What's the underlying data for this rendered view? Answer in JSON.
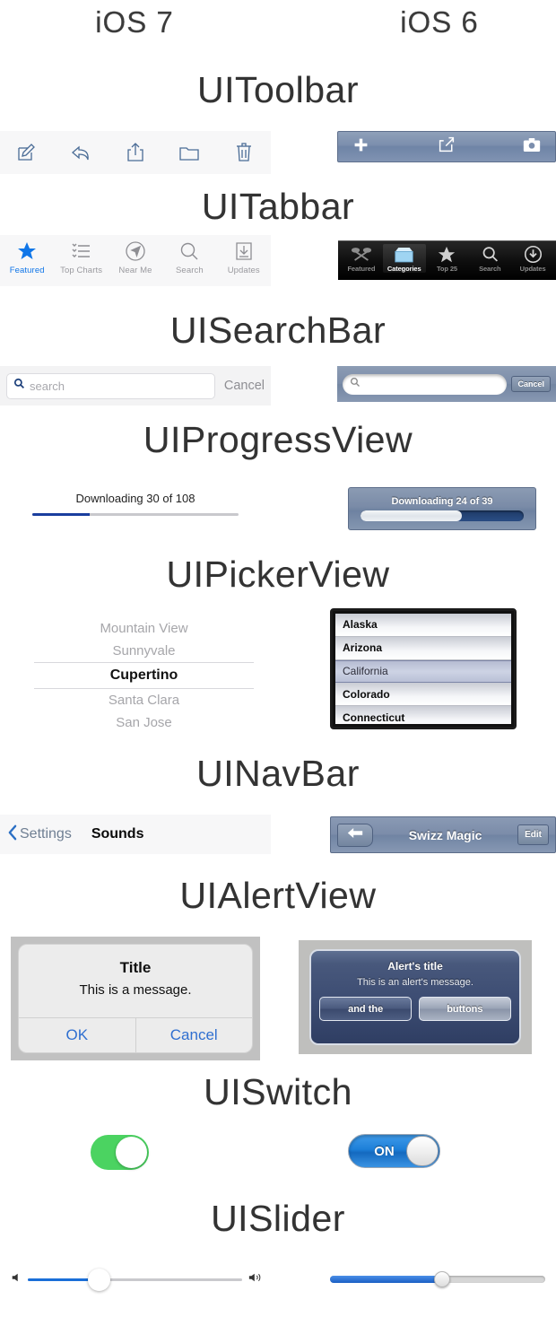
{
  "columns": {
    "left": "iOS 7",
    "right": "iOS 6"
  },
  "sections": {
    "toolbar": {
      "title": "UIToolbar"
    },
    "tabbar": {
      "title": "UITabbar"
    },
    "searchbar": {
      "title": "UISearchBar"
    },
    "progressview": {
      "title": "UIProgressView"
    },
    "pickerview": {
      "title": "UIPickerView"
    },
    "navbar": {
      "title": "UINavBar"
    },
    "alertview": {
      "title": "UIAlertView"
    },
    "uiswitch": {
      "title": "UISwitch"
    },
    "uislider": {
      "title": "UISlider"
    }
  },
  "toolbar": {
    "ios7": {
      "icons": [
        "compose-icon",
        "reply-icon",
        "share-icon",
        "folder-icon",
        "trash-icon"
      ],
      "tint": "#4a6c96"
    },
    "ios6": {
      "icons": [
        "plus-icon",
        "share-icon",
        "camera-icon"
      ],
      "tint": "#ffffff"
    }
  },
  "tabbar": {
    "ios7": {
      "selected_index": 0,
      "accent": "#1076e8",
      "items": [
        {
          "label": "Featured",
          "icon": "star-icon"
        },
        {
          "label": "Top Charts",
          "icon": "list-icon"
        },
        {
          "label": "Near Me",
          "icon": "compass-icon"
        },
        {
          "label": "Search",
          "icon": "search-icon"
        },
        {
          "label": "Updates",
          "icon": "download-box-icon"
        }
      ]
    },
    "ios6": {
      "selected_index": 1,
      "items": [
        {
          "label": "Featured",
          "icon": "ribbon-icon"
        },
        {
          "label": "Categories",
          "icon": "box-icon"
        },
        {
          "label": "Top 25",
          "icon": "star-icon"
        },
        {
          "label": "Search",
          "icon": "search-icon"
        },
        {
          "label": "Updates",
          "icon": "download-circle-icon"
        }
      ]
    }
  },
  "searchbar": {
    "ios7": {
      "placeholder": "search",
      "value": "",
      "cancel_label": "Cancel",
      "icon": "search-icon"
    },
    "ios6": {
      "placeholder": "",
      "value": "",
      "cancel_label": "Cancel",
      "icon": "search-icon"
    }
  },
  "progressview": {
    "ios7": {
      "label": "Downloading 30 of 108",
      "current": 30,
      "total": 108,
      "percent": 28
    },
    "ios6": {
      "label": "Downloading 24 of 39",
      "current": 24,
      "total": 39,
      "percent": 62
    }
  },
  "pickerview": {
    "ios7": {
      "selected": "Cupertino",
      "rows": [
        "Mountain View",
        "Sunnyvale",
        "Cupertino",
        "Santa Clara",
        "San Jose"
      ]
    },
    "ios6": {
      "selected": "California",
      "rows": [
        "Alaska",
        "Arizona",
        "California",
        "Colorado",
        "Connecticut"
      ]
    }
  },
  "navbar": {
    "ios7": {
      "back_label": "Settings",
      "title": "Sounds",
      "back_icon": "chevron-left-icon",
      "tint": "#6f7f93"
    },
    "ios6": {
      "back_label": "",
      "title": "Swizz Magic",
      "right_label": "Edit",
      "back_icon": "arrow-left-icon"
    }
  },
  "alertview": {
    "ios7": {
      "title": "Title",
      "message": "This is a message.",
      "buttons": [
        "OK",
        "Cancel"
      ],
      "button_tint": "#2f6fd0"
    },
    "ios6": {
      "title": "Alert's title",
      "message": "This is an alert's message.",
      "buttons": [
        "and the",
        "buttons"
      ]
    }
  },
  "uiswitch": {
    "ios7": {
      "on": true,
      "label": "",
      "on_color": "#4bd361"
    },
    "ios6": {
      "on": true,
      "label": "ON",
      "on_color": "#1d7fd8"
    }
  },
  "uislider": {
    "ios7": {
      "percent": 33,
      "left_icon": "volume-low-icon",
      "right_icon": "volume-high-icon",
      "fill_color": "#1a6fd8"
    },
    "ios6": {
      "percent": 52,
      "left_icon": "",
      "right_icon": "",
      "fill_color": "#1a5fc4"
    }
  }
}
